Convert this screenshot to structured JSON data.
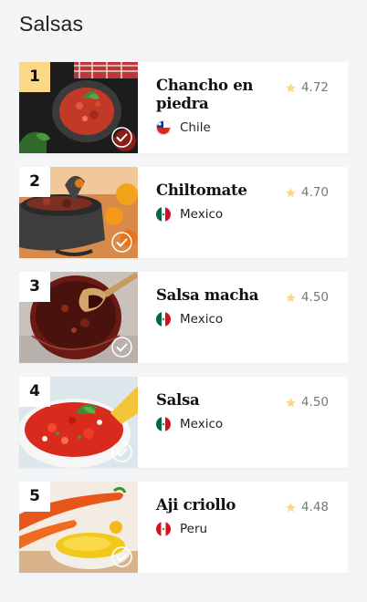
{
  "page": {
    "title": "Salsas"
  },
  "colors": {
    "rank_highlight": "#fcd788",
    "star": "#fcd788",
    "background": "#f4f5f7"
  },
  "items": [
    {
      "rank": "1",
      "name": "Chancho en piedra",
      "country": "Chile",
      "flag": "chile-flag-icon",
      "rating": "4.72"
    },
    {
      "rank": "2",
      "name": "Chiltomate",
      "country": "Mexico",
      "flag": "mexico-flag-icon",
      "rating": "4.70"
    },
    {
      "rank": "3",
      "name": "Salsa macha",
      "country": "Mexico",
      "flag": "mexico-flag-icon",
      "rating": "4.50"
    },
    {
      "rank": "4",
      "name": "Salsa",
      "country": "Mexico",
      "flag": "mexico-flag-icon",
      "rating": "4.50"
    },
    {
      "rank": "5",
      "name": "Aji criollo",
      "country": "Peru",
      "flag": "peru-flag-icon",
      "rating": "4.48"
    }
  ]
}
